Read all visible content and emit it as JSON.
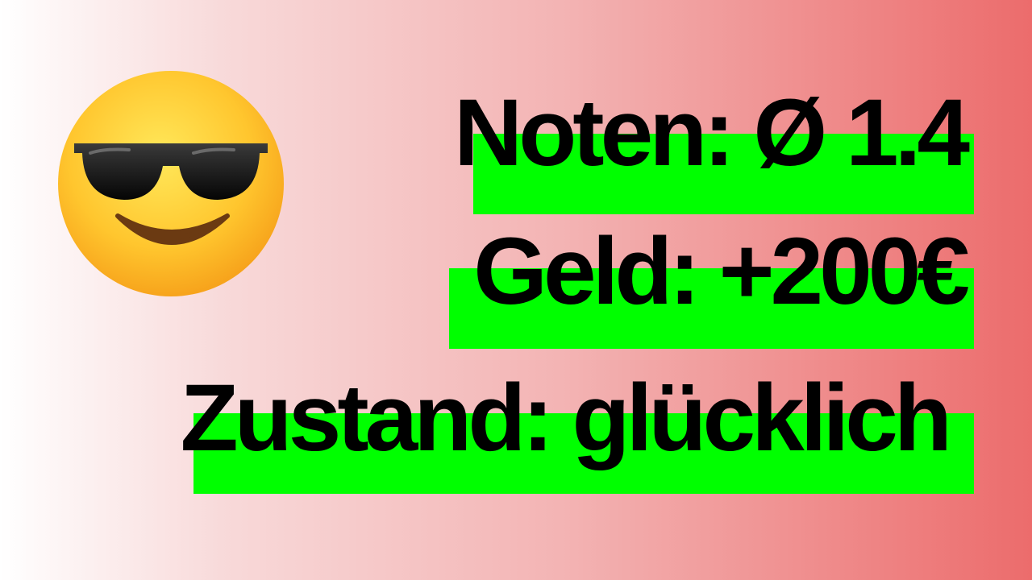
{
  "colors": {
    "highlight": "#00ff00",
    "background_start": "#ffffff",
    "background_end": "#ec6c6c",
    "text": "#000000"
  },
  "emoji": {
    "icon": "sunglasses-face-icon"
  },
  "lines": [
    {
      "text": "Noten: Ø 1.4"
    },
    {
      "text": "Geld: +200€"
    },
    {
      "text": "Zustand: glücklich"
    }
  ]
}
